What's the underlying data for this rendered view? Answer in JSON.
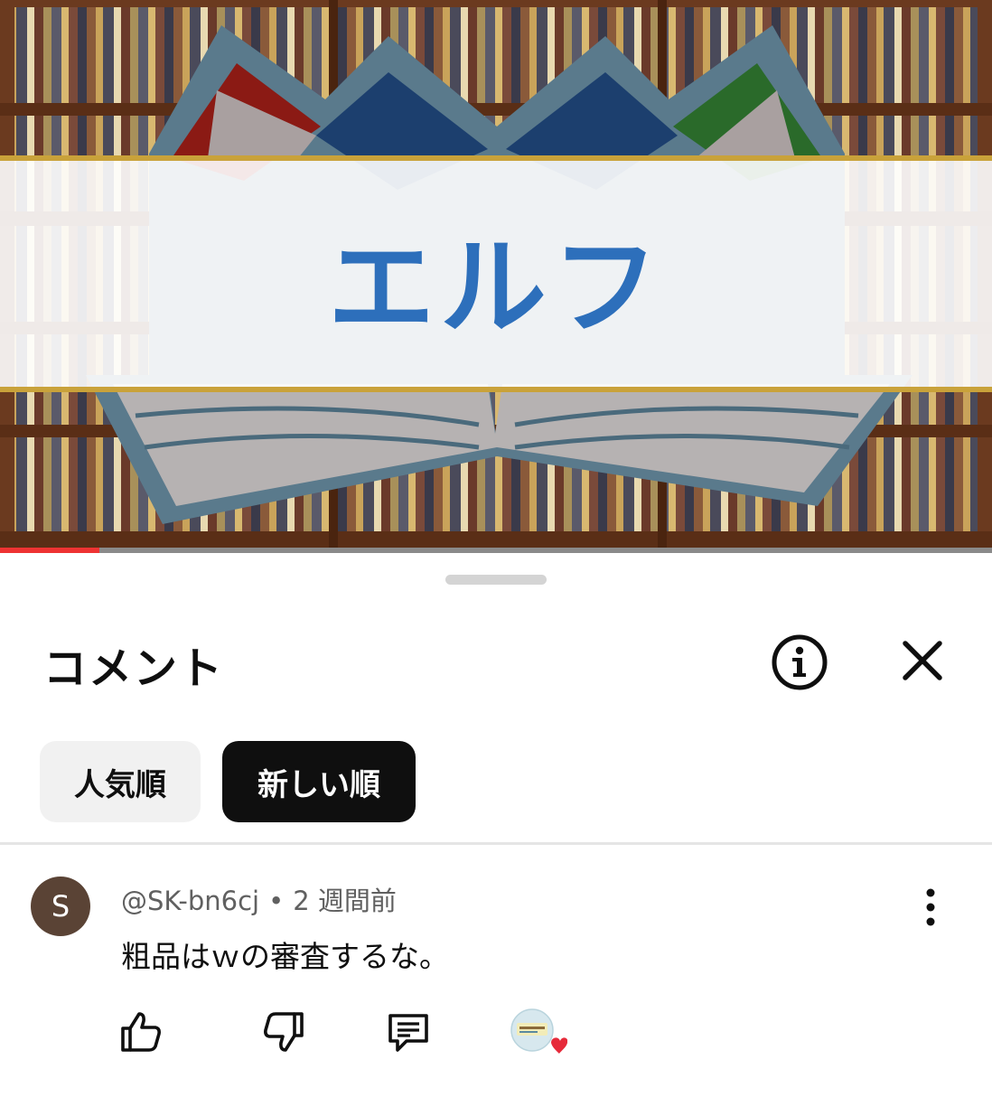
{
  "video": {
    "overlay_title": "エルフ",
    "progress_fraction": 0.1
  },
  "comments_sheet": {
    "title": "コメント",
    "icons": {
      "info": "info-icon",
      "close": "close-icon"
    },
    "sort_chips": [
      {
        "label": "人気順",
        "selected": false
      },
      {
        "label": "新しい順",
        "selected": true
      }
    ]
  },
  "comment": {
    "avatar_letter": "S",
    "avatar_color": "#5a4335",
    "author": "@SK-bn6cj",
    "separator": "•",
    "time": "2 週間前",
    "text": "粗品はｗの審査するな。",
    "icons": {
      "like": "thumbs-up-icon",
      "dislike": "thumbs-down-icon",
      "reply": "reply-icon",
      "more": "more-vert-icon",
      "creator_heart": "creator-heart-icon"
    }
  },
  "colors": {
    "banner_text": "#2d6fbb",
    "banner_border": "#c9a23a",
    "selected_chip": "#0f0f0f",
    "unselected_chip": "#f1f1f1",
    "heart": "#e62a3a"
  }
}
